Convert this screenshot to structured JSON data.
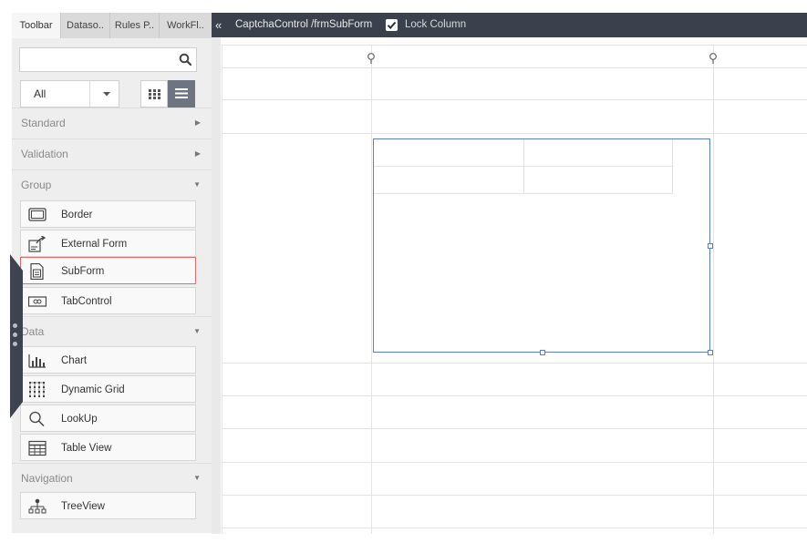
{
  "panel": {
    "tabs": [
      "Toolbar",
      "Dataso..",
      "Rules P..",
      "WorkFl.."
    ],
    "search": {
      "value": "",
      "placeholder": ""
    },
    "filter": {
      "value": "All"
    },
    "sections": {
      "standard": "Standard",
      "validation": "Validation",
      "group": "Group",
      "data": "Data",
      "navigation": "Navigation"
    },
    "group_items": [
      "Border",
      "External Form",
      "SubForm",
      "TabControl"
    ],
    "data_items": [
      "Chart",
      "Dynamic Grid",
      "LookUp",
      "Table View"
    ],
    "navigation_items": [
      "TreeView"
    ],
    "selected_item": "SubForm"
  },
  "header": {
    "collapse_glyph": "«",
    "path": "CaptchaControl /frmSubForm",
    "lock_label": "Lock Column",
    "lock_checked": true
  },
  "icons": {
    "search": "search-icon",
    "filter": "chevron-down-icon",
    "grid_view": "grid-view-icon",
    "list_view": "list-view-icon",
    "border": "border-icon",
    "external_form": "external-form-icon",
    "subform": "subform-icon",
    "tabcontrol": "tabcontrol-icon",
    "chart": "chart-icon",
    "dynamic_grid": "dynamic-grid-icon",
    "lookup": "lookup-icon",
    "table_view": "table-view-icon",
    "treeview": "treeview-icon",
    "pin": "pin-icon"
  },
  "colors": {
    "header_bg": "#3b414c",
    "selection_border": "#5b7bd5",
    "selected_item_border": "#e36b6b",
    "active_view_btn": "#6e7580"
  }
}
